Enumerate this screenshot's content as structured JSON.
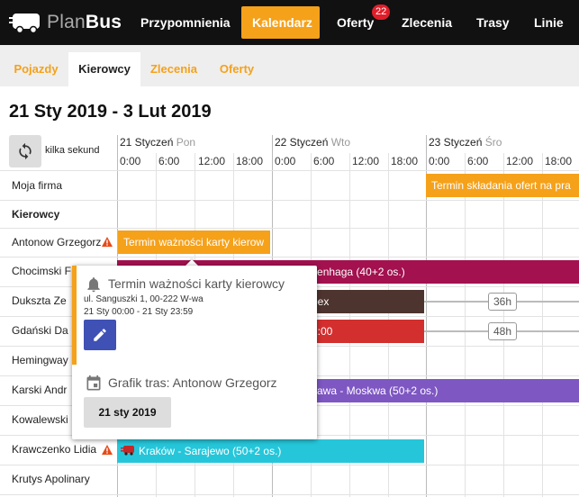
{
  "logo": {
    "part1": "Plan",
    "part2": "Bus"
  },
  "nav": [
    {
      "label": "Przypomnienia",
      "active": false
    },
    {
      "label": "Kalendarz",
      "active": true
    },
    {
      "label": "Oferty",
      "active": false,
      "badge": "22"
    },
    {
      "label": "Zlecenia",
      "active": false
    },
    {
      "label": "Trasy",
      "active": false
    },
    {
      "label": "Linie",
      "active": false
    }
  ],
  "subtabs": [
    {
      "label": "Pojazdy",
      "active": false
    },
    {
      "label": "Kierowcy",
      "active": true
    },
    {
      "label": "Zlecenia",
      "active": false
    },
    {
      "label": "Oferty",
      "active": false
    }
  ],
  "range_title": "21 Sty 2019 - 3 Lut 2019",
  "refresh_label": "kilka sekund",
  "days": [
    {
      "date": "21 Styczeń",
      "dow": "Pon"
    },
    {
      "date": "22 Styczeń",
      "dow": "Wto"
    },
    {
      "date": "23 Styczeń",
      "dow": "Śro"
    }
  ],
  "hours": [
    "0:00",
    "6:00",
    "12:00",
    "18:00",
    "0:00",
    "6:00",
    "12:00",
    "18:00",
    "0:00",
    "6:00",
    "12:00",
    "18:00"
  ],
  "rows": {
    "company": "Moja firma",
    "section": "Kierowcy",
    "drivers": [
      "Antonow Grzegorz",
      "Chocimski F",
      "Dukszta Ze",
      "Gdański Da",
      "Hemingway",
      "Karski Andr",
      "Kowalewski",
      "Krawczenko Lidia",
      "Krutys Apolinary"
    ]
  },
  "events": {
    "company_deadline": "Termin składania ofert na pra",
    "antonow_card": "Termin ważności karty kierow",
    "chocimski": "sk - Kopenhaga (40+2 os.)",
    "dukszta": "bex",
    "gdanski": "1:00",
    "karski": "zawa - Moskwa (50+2 os.)",
    "krawczenko": "Kraków - Sarajewo (50+2 os.)",
    "dur1": "36h",
    "dur2": "48h"
  },
  "popup": {
    "title": "Termin ważności karty kierowcy",
    "address": "ul. Sanguszki 1, 00-222 W-wa",
    "dates": "21 Sty 00:00 - 21 Sty 23:59",
    "schedule_title": "Grafik tras: Antonow Grzegorz",
    "date_button": "21 sty 2019"
  },
  "colors": {
    "accent": "#f5a11a",
    "purple_route": "#a3114f",
    "brown_route": "#4e342e",
    "red_route": "#d32f2f",
    "violet_route": "#7e57c2",
    "cyan_route": "#26c6da",
    "edit_button": "#3f51b5"
  }
}
